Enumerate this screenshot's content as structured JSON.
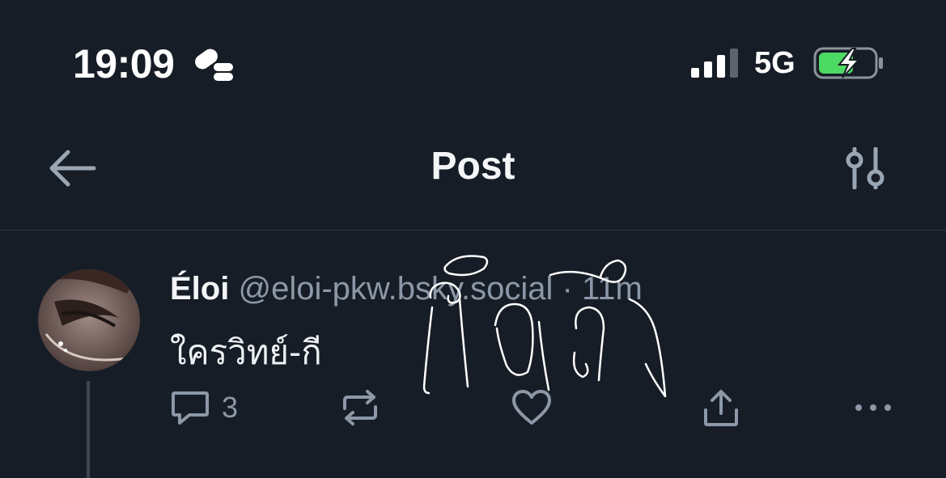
{
  "status": {
    "time": "19:09",
    "network": "5G"
  },
  "header": {
    "title": "Post",
    "back_icon": "arrow-left-icon",
    "filter_icon": "sliders-icon"
  },
  "post": {
    "author_name": "Éloi",
    "handle": "@eloi-pkw.bsky.social",
    "separator": "·",
    "age": "11m",
    "text": "ใครวิทย์-กี",
    "reply_count": "3"
  },
  "colors": {
    "background": "#171d26",
    "muted": "#8c98a7",
    "divider": "#2f3946",
    "battery_green": "#4cd964"
  }
}
